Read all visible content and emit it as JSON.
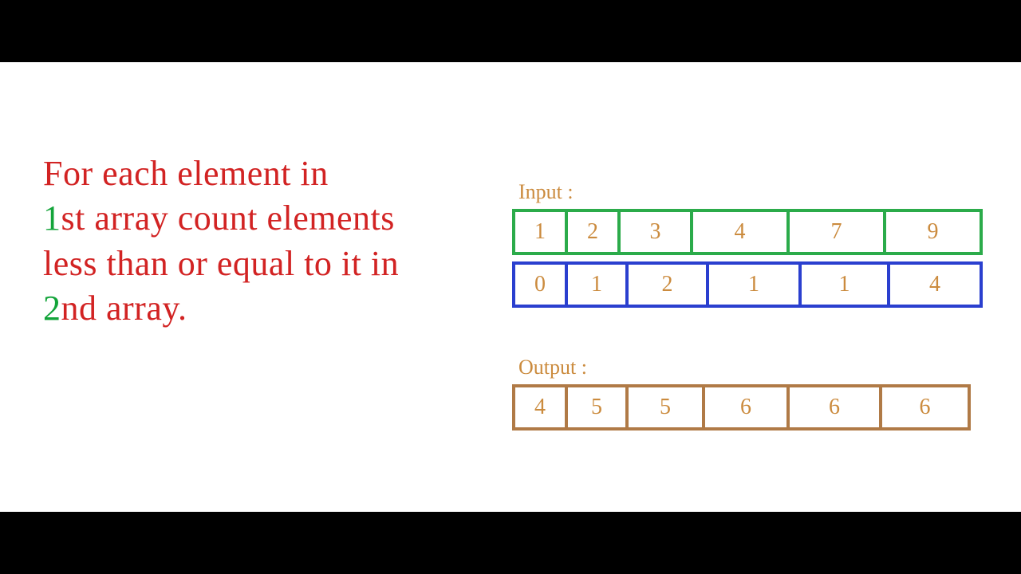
{
  "text": {
    "line1": "For each element in",
    "ord1_digit": "1",
    "ord1_suffix": "st",
    "line2_rest": " array count elements",
    "line3": "less than or equal to it in",
    "ord2_digit": "2",
    "ord2_suffix": "nd",
    "line4_rest": " array."
  },
  "labels": {
    "input": "Input :",
    "output": "Output :"
  },
  "arrays": {
    "first": [
      "1",
      "2",
      "3",
      "4",
      "7",
      "9"
    ],
    "second": [
      "0",
      "1",
      "2",
      "1",
      "1",
      "4"
    ],
    "output": [
      "4",
      "5",
      "5",
      "6",
      "6",
      "6"
    ]
  },
  "cell_widths": {
    "first": [
      70,
      70,
      95,
      125,
      125,
      125
    ],
    "second": [
      70,
      80,
      105,
      120,
      115,
      120
    ],
    "output": [
      70,
      80,
      100,
      110,
      120,
      115
    ]
  },
  "colors": {
    "green_border": "#2bab4a",
    "blue_border": "#2a3fcf",
    "brown_border": "#b07a46",
    "text_red": "#d22323",
    "text_green": "#13a43a",
    "text_brown": "#cb8b3e"
  }
}
